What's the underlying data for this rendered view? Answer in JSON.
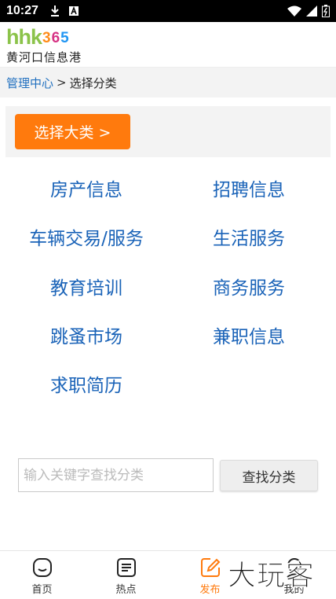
{
  "status_bar": {
    "time": "10:27"
  },
  "header": {
    "logo_mark": "hhk",
    "logo_digits": [
      "3",
      "6",
      "5"
    ],
    "logo_subtitle": "黄河口信息港"
  },
  "breadcrumb": {
    "link": "管理中心",
    "separator": ">",
    "current": "选择分类"
  },
  "select_button": {
    "label": "选择大类 >"
  },
  "categories": [
    "房产信息",
    "招聘信息",
    "车辆交易/服务",
    "生活服务",
    "教育培训",
    "商务服务",
    "跳蚤市场",
    "兼职信息",
    "求职简历"
  ],
  "search": {
    "placeholder": "输入关键字查找分类",
    "value": "",
    "button_label": "查找分类"
  },
  "bottom_nav": [
    {
      "label": "首页",
      "icon": "home-icon"
    },
    {
      "label": "热点",
      "icon": "news-icon"
    },
    {
      "label": "发布",
      "icon": "edit-icon",
      "active": true
    },
    {
      "label": "我的",
      "icon": "profile-icon"
    }
  ],
  "watermark": {
    "text": "大玩客"
  },
  "colors": {
    "accent": "#ff7a0d",
    "link": "#1a63b8",
    "logo_green": "#8bc34a"
  }
}
